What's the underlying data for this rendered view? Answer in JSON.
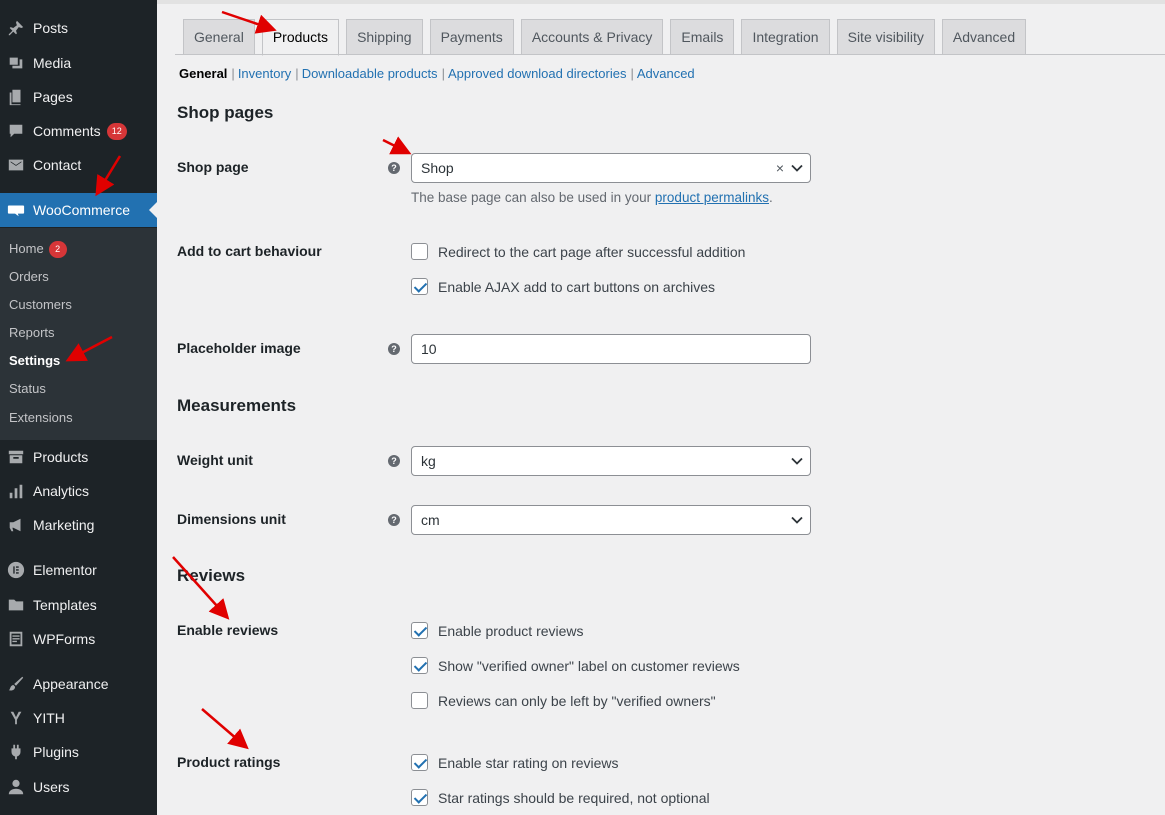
{
  "sidebar": {
    "items": [
      {
        "label": "Posts",
        "icon": "pin-icon"
      },
      {
        "label": "Media",
        "icon": "media-icon"
      },
      {
        "label": "Pages",
        "icon": "pages-icon"
      },
      {
        "label": "Comments",
        "icon": "comment-icon",
        "badge": "12"
      },
      {
        "label": "Contact",
        "icon": "mail-icon"
      },
      {
        "label": "WooCommerce",
        "icon": "woo-icon"
      },
      {
        "label": "Products",
        "icon": "archive-icon"
      },
      {
        "label": "Analytics",
        "icon": "chart-icon"
      },
      {
        "label": "Marketing",
        "icon": "megaphone-icon"
      },
      {
        "label": "Elementor",
        "icon": "elementor-icon"
      },
      {
        "label": "Templates",
        "icon": "folder-icon"
      },
      {
        "label": "WPForms",
        "icon": "form-icon"
      },
      {
        "label": "Appearance",
        "icon": "brush-icon"
      },
      {
        "label": "YITH",
        "icon": "yith-icon"
      },
      {
        "label": "Plugins",
        "icon": "plug-icon"
      },
      {
        "label": "Users",
        "icon": "user-icon"
      }
    ],
    "submenu": [
      {
        "label": "Home",
        "badge": "2"
      },
      {
        "label": "Orders"
      },
      {
        "label": "Customers"
      },
      {
        "label": "Reports"
      },
      {
        "label": "Settings"
      },
      {
        "label": "Status"
      },
      {
        "label": "Extensions"
      }
    ]
  },
  "tabs": [
    "General",
    "Products",
    "Shipping",
    "Payments",
    "Accounts & Privacy",
    "Emails",
    "Integration",
    "Site visibility",
    "Advanced"
  ],
  "subnav": [
    "General",
    "Inventory",
    "Downloadable products",
    "Approved download directories",
    "Advanced"
  ],
  "sections": {
    "shop_pages": "Shop pages",
    "measurements": "Measurements",
    "reviews": "Reviews"
  },
  "fields": {
    "shop_page": {
      "label": "Shop page",
      "value": "Shop",
      "clear": "×",
      "desc_pre": "The base page can also be used in your ",
      "desc_link": "product permalinks",
      "desc_post": "."
    },
    "add_to_cart": {
      "label": "Add to cart behaviour",
      "opt1": "Redirect to the cart page after successful addition",
      "opt2": "Enable AJAX add to cart buttons on archives"
    },
    "placeholder": {
      "label": "Placeholder image",
      "value": "10"
    },
    "weight": {
      "label": "Weight unit",
      "value": "kg"
    },
    "dimensions": {
      "label": "Dimensions unit",
      "value": "cm"
    },
    "enable_reviews": {
      "label": "Enable reviews",
      "opt1": "Enable product reviews",
      "opt2": "Show \"verified owner\" label on customer reviews",
      "opt3": "Reviews can only be left by \"verified owners\""
    },
    "ratings": {
      "label": "Product ratings",
      "opt1": "Enable star rating on reviews",
      "opt2": "Star ratings should be required, not optional"
    }
  },
  "colors": {
    "accent": "#2271b1",
    "sidebar": "#1d2327",
    "badge": "#d63638",
    "arrow": "#e00000"
  }
}
